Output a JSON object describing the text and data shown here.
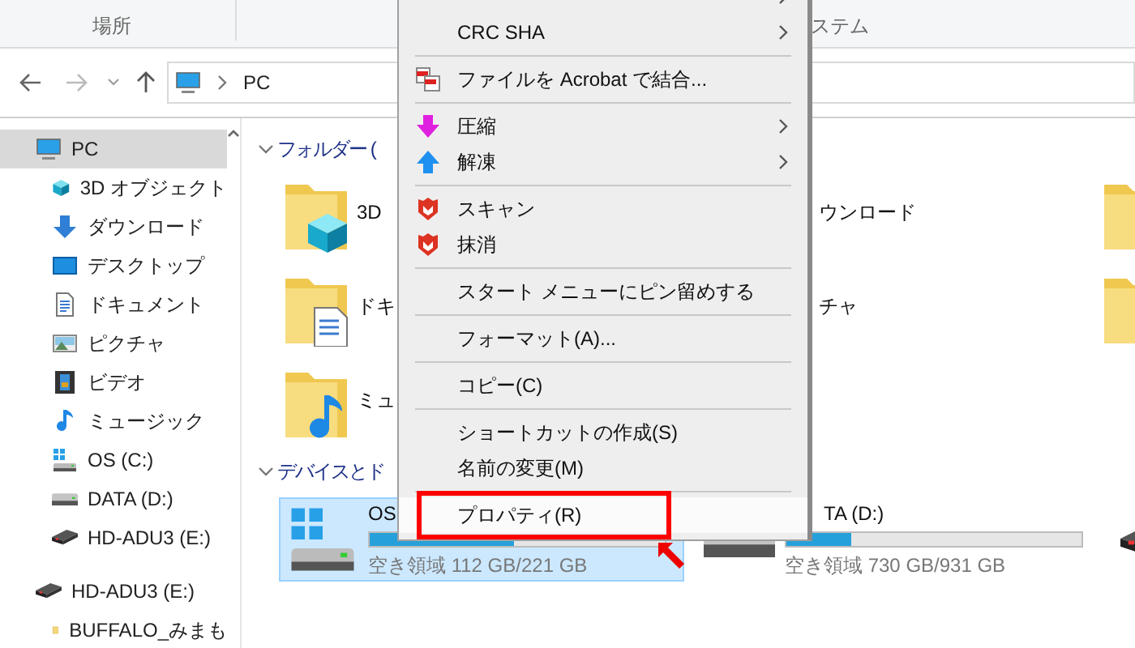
{
  "ribbon": {
    "groups": [
      {
        "label": "場所"
      },
      {
        "label": "ステム"
      }
    ]
  },
  "address_bar": {
    "path": [
      "PC"
    ]
  },
  "sidebar": {
    "items": [
      {
        "label": "PC",
        "kind": "pc",
        "selected": true,
        "children": [
          {
            "label": "3D オブジェクト",
            "kind": "cube",
            "selected": false
          },
          {
            "label": "ダウンロード",
            "kind": "download",
            "selected": false
          },
          {
            "label": "デスクトップ",
            "kind": "desktop",
            "selected": false
          },
          {
            "label": "ドキュメント",
            "kind": "document",
            "selected": false
          },
          {
            "label": "ピクチャ",
            "kind": "picture",
            "selected": false
          },
          {
            "label": "ビデオ",
            "kind": "video",
            "selected": false
          },
          {
            "label": "ミュージック",
            "kind": "music",
            "selected": false
          },
          {
            "label": "OS (C:)",
            "kind": "windows-drive",
            "selected": false
          },
          {
            "label": "DATA (D:)",
            "kind": "drive",
            "selected": false
          },
          {
            "label": "HD-ADU3 (E:)",
            "kind": "external-drive",
            "selected": false
          }
        ]
      },
      {
        "label": "HD-ADU3 (E:)",
        "kind": "external-drive",
        "selected": false,
        "children": [
          {
            "label": "BUFFALO_みまも",
            "kind": "folder",
            "selected": false
          }
        ]
      }
    ]
  },
  "folders": {
    "title": "フォルダー (",
    "rows": [
      [
        {
          "label": "3D",
          "kind": "cube"
        },
        {
          "label": "ウンロード"
        },
        {
          "kind": "plain"
        }
      ],
      [
        {
          "label": "ドキ",
          "kind": "document"
        },
        {
          "label": "チャ"
        },
        {
          "kind": "plain"
        }
      ],
      [
        {
          "label": "ミュ",
          "kind": "music"
        }
      ]
    ]
  },
  "devices": {
    "title": "デバイスとド",
    "drives": [
      {
        "name": "OS",
        "kind": "windows-drive",
        "level": 0.49,
        "free": "空き領域 112 GB/221 GB",
        "selected": true
      },
      {
        "name": "TA (D:)",
        "kind": "drive",
        "level": 0.22,
        "free": "空き領域 730 GB/931 GB",
        "selected": false
      },
      {
        "kind": "external-drive",
        "selected": false
      }
    ]
  },
  "context_menu": {
    "items": [
      {
        "kind": "plain",
        "submenu": true,
        "selected": false
      },
      {
        "kind": "plain",
        "label": "CRC SHA",
        "submenu": true,
        "selected": false
      },
      {
        "kind": "separator"
      },
      {
        "kind": "acrobat",
        "label": "ファイルを Acrobat で結合...",
        "submenu": false,
        "selected": false
      },
      {
        "kind": "separator"
      },
      {
        "kind": "compress",
        "label": "圧縮",
        "submenu": true,
        "selected": false
      },
      {
        "kind": "extract",
        "label": "解凍",
        "submenu": true,
        "selected": false
      },
      {
        "kind": "separator"
      },
      {
        "kind": "shield",
        "label": "スキャン",
        "submenu": false,
        "selected": false
      },
      {
        "kind": "shield",
        "label": "抹消",
        "submenu": false,
        "selected": false
      },
      {
        "kind": "separator"
      },
      {
        "kind": "plain",
        "label": "スタート メニューにピン留めする",
        "submenu": false,
        "selected": false
      },
      {
        "kind": "separator"
      },
      {
        "kind": "plain",
        "label": "フォーマット(A)...",
        "submenu": false,
        "selected": false
      },
      {
        "kind": "separator"
      },
      {
        "kind": "plain",
        "label": "コピー(C)",
        "submenu": false,
        "selected": false
      },
      {
        "kind": "separator"
      },
      {
        "kind": "plain",
        "label": "ショートカットの作成(S)",
        "submenu": false,
        "selected": false
      },
      {
        "kind": "plain",
        "label": "名前の変更(M)",
        "submenu": false,
        "selected": false
      },
      {
        "kind": "separator"
      },
      {
        "kind": "plain",
        "label": "プロパティ(R)",
        "submenu": false,
        "selected": true,
        "outlined": true
      }
    ]
  }
}
